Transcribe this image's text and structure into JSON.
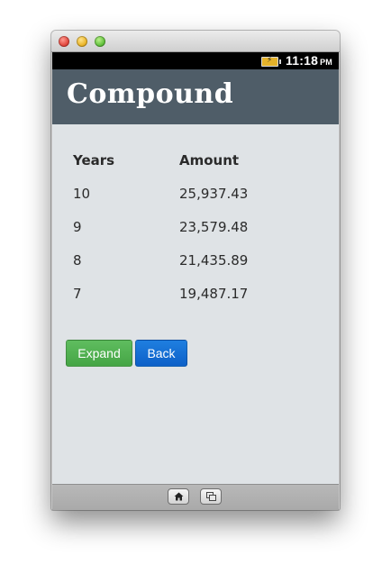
{
  "window": {
    "controls": [
      "close",
      "minimize",
      "maximize"
    ]
  },
  "status_bar": {
    "battery_icon": "battery-charging-icon",
    "time": "11:18",
    "ampm": "PM"
  },
  "app": {
    "title": "Compound",
    "table": {
      "headers": [
        "Years",
        "Amount"
      ],
      "rows": [
        {
          "years": "10",
          "amount": "25,937.43"
        },
        {
          "years": "9",
          "amount": "23,579.48"
        },
        {
          "years": "8",
          "amount": "21,435.89"
        },
        {
          "years": "7",
          "amount": "19,487.17"
        }
      ]
    },
    "buttons": {
      "expand_label": "Expand",
      "back_label": "Back"
    }
  },
  "nav_bar": {
    "home_icon": "home-icon",
    "windows_icon": "windows-icon"
  },
  "colors": {
    "header_bg": "#4f5d68",
    "content_bg": "#dfe3e6",
    "expand_button": "#4cae4c",
    "back_button": "#1169d6"
  }
}
